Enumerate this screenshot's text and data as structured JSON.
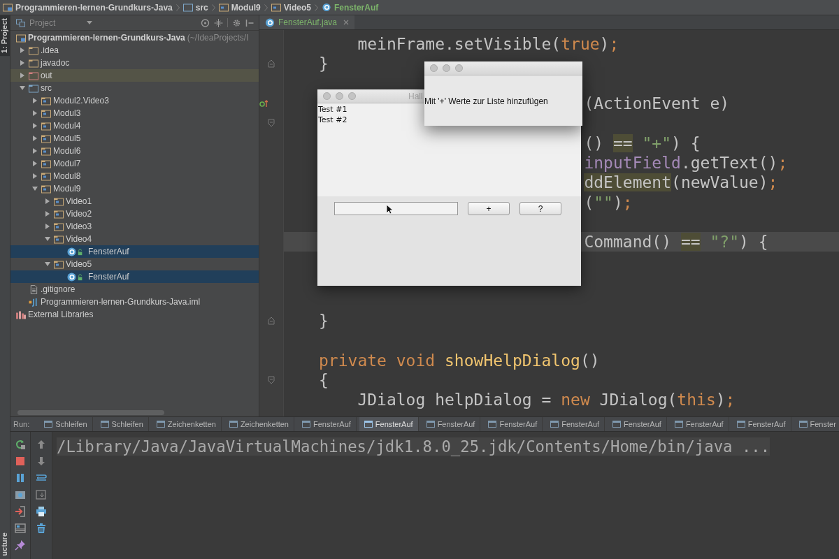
{
  "breadcrumbs": [
    {
      "kind": "project",
      "label": "Programmieren-lernen-Grundkurs-Java"
    },
    {
      "kind": "source-folder",
      "label": "src"
    },
    {
      "kind": "package",
      "label": "Modul9"
    },
    {
      "kind": "package",
      "label": "Video5"
    },
    {
      "kind": "class",
      "label": "FensterAuf"
    }
  ],
  "side_strip": {
    "top_tab": "1: Project",
    "bottom_tab": "ucture"
  },
  "project_panel": {
    "view": "Project",
    "root_label": "Programmieren-lernen-Grundkurs-Java",
    "root_hint": "(~/IdeaProjects/I",
    "items": [
      {
        "kind": "folder",
        "label": ".idea",
        "expanded": false,
        "selected": false,
        "hovered": false
      },
      {
        "kind": "folder",
        "label": "javadoc",
        "expanded": false,
        "selected": false,
        "hovered": false
      },
      {
        "kind": "excluded-folder",
        "label": "out",
        "expanded": false,
        "selected": false,
        "hovered": true
      },
      {
        "kind": "source-folder",
        "label": "src",
        "expanded": true,
        "selected": false,
        "hovered": false,
        "children": [
          {
            "kind": "package",
            "label": "Modul2.Video3",
            "expanded": false,
            "selected": false,
            "hovered": false
          },
          {
            "kind": "package",
            "label": "Modul3",
            "expanded": false,
            "selected": false,
            "hovered": false
          },
          {
            "kind": "package",
            "label": "Modul4",
            "expanded": false,
            "selected": false,
            "hovered": false
          },
          {
            "kind": "package",
            "label": "Modul5",
            "expanded": false,
            "selected": false,
            "hovered": false
          },
          {
            "kind": "package",
            "label": "Modul6",
            "expanded": false,
            "selected": false,
            "hovered": false
          },
          {
            "kind": "package",
            "label": "Modul7",
            "expanded": false,
            "selected": false,
            "hovered": false
          },
          {
            "kind": "package",
            "label": "Modul8",
            "expanded": false,
            "selected": false,
            "hovered": false
          },
          {
            "kind": "package",
            "label": "Modul9",
            "expanded": true,
            "selected": false,
            "hovered": false,
            "children": [
              {
                "kind": "package",
                "label": "Video1",
                "expanded": false,
                "selected": false,
                "hovered": false
              },
              {
                "kind": "package",
                "label": "Video2",
                "expanded": false,
                "selected": false,
                "hovered": false
              },
              {
                "kind": "package",
                "label": "Video3",
                "expanded": false,
                "selected": false,
                "hovered": false
              },
              {
                "kind": "package",
                "label": "Video4",
                "expanded": true,
                "selected": false,
                "hovered": false,
                "children": [
                  {
                    "kind": "class",
                    "label": "FensterAuf",
                    "selected": true,
                    "hovered": false
                  }
                ]
              },
              {
                "kind": "package",
                "label": "Video5",
                "expanded": true,
                "selected": false,
                "hovered": false,
                "children": [
                  {
                    "kind": "class",
                    "label": "FensterAuf",
                    "selected": true,
                    "hovered": false
                  }
                ]
              }
            ]
          }
        ]
      },
      {
        "kind": "file",
        "label": ".gitignore",
        "selected": false,
        "hovered": false
      },
      {
        "kind": "module-file",
        "label": "Programmieren-lernen-Grundkurs-Java.iml",
        "selected": false,
        "hovered": false
      }
    ],
    "external_libraries": "External Libraries"
  },
  "editor": {
    "tab": "FensterAuf.java",
    "lines": [
      {
        "kind": "code",
        "current": false,
        "partly_hidden": false,
        "segments": [
          {
            "kind": "plain",
            "text": "    meinFrame.setVisible("
          },
          {
            "kind": "keyword",
            "text": "true"
          },
          {
            "kind": "plain",
            "text": ")"
          },
          {
            "kind": "keyword",
            "text": ";"
          }
        ]
      },
      {
        "kind": "code",
        "current": false,
        "partly_hidden": false,
        "gutter": {
          "kind": "fold-end"
        },
        "segments": [
          {
            "kind": "plain",
            "text": "}"
          }
        ]
      },
      {
        "kind": "blank",
        "current": false
      },
      {
        "kind": "code",
        "current": false,
        "partly_hidden": true,
        "gutter": {
          "kind": "override"
        },
        "segments": [
          {
            "kind": "plain",
            "text": "(ActionEvent e)"
          }
        ]
      },
      {
        "kind": "blank",
        "current": false,
        "gutter": {
          "kind": "fold-start"
        }
      },
      {
        "kind": "code",
        "current": false,
        "partly_hidden": true,
        "segments": [
          {
            "kind": "plain",
            "text": "() "
          },
          {
            "kind": "marked",
            "text": "=="
          },
          {
            "kind": "string",
            "text": " \"+\""
          },
          {
            "kind": "plain",
            "text": ") {"
          }
        ]
      },
      {
        "kind": "code",
        "current": false,
        "partly_hidden": true,
        "segments": [
          {
            "kind": "field",
            "text": "inputField"
          },
          {
            "kind": "plain",
            "text": ".getText()"
          },
          {
            "kind": "keyword",
            "text": ";"
          }
        ]
      },
      {
        "kind": "code",
        "current": false,
        "partly_hidden": true,
        "segments": [
          {
            "kind": "marked",
            "text": "ddElement"
          },
          {
            "kind": "plain",
            "text": "(newValue)"
          },
          {
            "kind": "keyword",
            "text": ";"
          }
        ]
      },
      {
        "kind": "code",
        "current": false,
        "partly_hidden": true,
        "segments": [
          {
            "kind": "plain",
            "text": "("
          },
          {
            "kind": "string",
            "text": "\"\""
          },
          {
            "kind": "plain",
            "text": ")"
          },
          {
            "kind": "keyword",
            "text": ";"
          }
        ]
      },
      {
        "kind": "blank",
        "current": false
      },
      {
        "kind": "code",
        "current": true,
        "partly_hidden": true,
        "segments": [
          {
            "kind": "plain",
            "text": "Command() "
          },
          {
            "kind": "marked",
            "text": "=="
          },
          {
            "kind": "string",
            "text": " \"?\""
          },
          {
            "kind": "plain",
            "text": ") {"
          }
        ]
      },
      {
        "kind": "blank",
        "current": false
      },
      {
        "kind": "blank",
        "current": false
      },
      {
        "kind": "blank",
        "current": false
      },
      {
        "kind": "code",
        "current": false,
        "partly_hidden": false,
        "gutter": {
          "kind": "fold-end"
        },
        "segments": [
          {
            "kind": "plain",
            "text": "}"
          }
        ]
      },
      {
        "kind": "blank",
        "current": false
      },
      {
        "kind": "code",
        "current": false,
        "partly_hidden": false,
        "segments": [
          {
            "kind": "keyword",
            "text": "private void "
          },
          {
            "kind": "method",
            "text": "showHelpDialog"
          },
          {
            "kind": "plain",
            "text": "()"
          }
        ]
      },
      {
        "kind": "code",
        "current": false,
        "partly_hidden": false,
        "gutter": {
          "kind": "fold-start"
        },
        "segments": [
          {
            "kind": "plain",
            "text": "{"
          }
        ]
      },
      {
        "kind": "code",
        "current": false,
        "partly_hidden": false,
        "segments": [
          {
            "kind": "plain",
            "text": "    JDialog helpDialog = "
          },
          {
            "kind": "keyword",
            "text": "new"
          },
          {
            "kind": "plain",
            "text": " JDialog("
          },
          {
            "kind": "keyword",
            "text": "this"
          },
          {
            "kind": "plain",
            "text": ")"
          },
          {
            "kind": "keyword",
            "text": ";"
          }
        ]
      }
    ]
  },
  "app_window": {
    "title": "Hall",
    "list_items": [
      "Test #1",
      "Test #2"
    ],
    "buttons": [
      "+",
      "?"
    ]
  },
  "help_dialog": {
    "message": "Mit '+' Werte zur Liste hinzufügen"
  },
  "run_tabs": {
    "label": "Run:",
    "tabs": [
      {
        "label": "Schleifen",
        "selected": false
      },
      {
        "label": "Schleifen",
        "selected": false
      },
      {
        "label": "Zeichenketten",
        "selected": false
      },
      {
        "label": "Zeichenketten",
        "selected": false
      },
      {
        "label": "FensterAuf",
        "selected": false
      },
      {
        "label": "FensterAuf",
        "selected": true
      },
      {
        "label": "FensterAuf",
        "selected": false
      },
      {
        "label": "FensterAuf",
        "selected": false
      },
      {
        "label": "FensterAuf",
        "selected": false
      },
      {
        "label": "FensterAuf",
        "selected": false
      },
      {
        "label": "FensterAuf",
        "selected": false
      },
      {
        "label": "FensterAuf",
        "selected": false
      },
      {
        "label": "Fenster",
        "selected": false
      }
    ]
  },
  "run_output": {
    "command": "/Library/Java/JavaVirtualMachines/jdk1.8.0_25.jdk/Contents/Home/bin/java ..."
  }
}
